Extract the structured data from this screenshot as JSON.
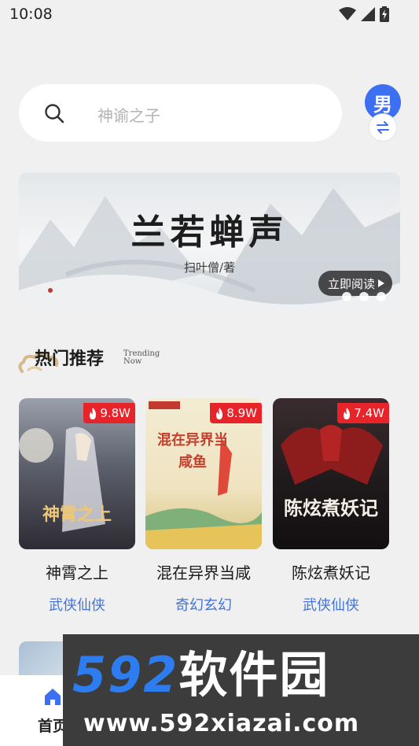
{
  "status_bar": {
    "time": "10:08",
    "icons": [
      "wifi-icon",
      "signal-icon",
      "battery-charging-icon"
    ]
  },
  "search": {
    "placeholder": "神谕之子"
  },
  "gender": {
    "label": "男",
    "swap_icon": "swap-arrows-icon"
  },
  "banner": {
    "title": "兰若蝉声",
    "author": "扫叶僧/著",
    "read_button": "立即阅读",
    "page_count": 3
  },
  "section": {
    "title": "热门推荐",
    "subtitle_line1": "Trending",
    "subtitle_line2": "Now"
  },
  "books": [
    {
      "cover_title": "神霄之上",
      "heat": "9.8W",
      "title": "神霄之上",
      "genre": "武侠仙侠"
    },
    {
      "cover_title": "混在异界当咸鱼",
      "heat": "8.9W",
      "title": "混在异界当咸",
      "genre": "奇幻玄幻"
    },
    {
      "cover_title": "陈炫煮妖记",
      "heat": "7.4W",
      "title": "陈炫煮妖记",
      "genre": "武侠仙侠"
    }
  ],
  "nav": {
    "home_label": "首页",
    "home_icon": "home-icon"
  },
  "watermark": {
    "logo_num": "592",
    "logo_text": "软件园",
    "url": "www.592xiazai.com"
  },
  "colors": {
    "accent": "#3d6ff2",
    "heat_badge": "#e8242b",
    "genre": "#4474d6"
  }
}
